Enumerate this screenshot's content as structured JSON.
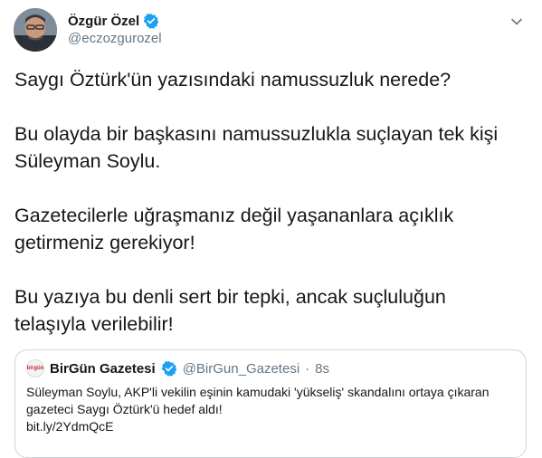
{
  "author": {
    "name": "Özgür Özel",
    "handle": "@eczozgurozel"
  },
  "tweet": {
    "paragraphs": [
      "Saygı Öztürk'ün yazısındaki namussuzluk nerede?",
      "Bu olayda bir başkasını namussuzlukla suçlayan tek kişi Süleyman Soylu.",
      "Gazetecilerle uğraşmanız değil yaşananlara açıklık getirmeniz gerekiyor!",
      "Bu yazıya bu denli sert bir tepki, ancak suçluluğun telaşıyla verilebilir!"
    ]
  },
  "quoted": {
    "avatar_text": "birgün",
    "name": "BirGün Gazetesi",
    "handle": "@BirGun_Gazetesi",
    "separator": "·",
    "time": "8s",
    "lines": [
      "Süleyman Soylu, AKP'li vekilin eşinin kamudaki 'yükseliş' skandalını ortaya çıkaran",
      "gazeteci Saygı Öztürk'ü hedef aldı!",
      "bit.ly/2YdmQcE"
    ]
  },
  "colors": {
    "verified": "#1da1f2",
    "secondary_text": "#657786",
    "border": "#ccd6dd"
  },
  "icons": {
    "verified": "verified-badge-icon",
    "caret": "chevron-down-icon"
  }
}
